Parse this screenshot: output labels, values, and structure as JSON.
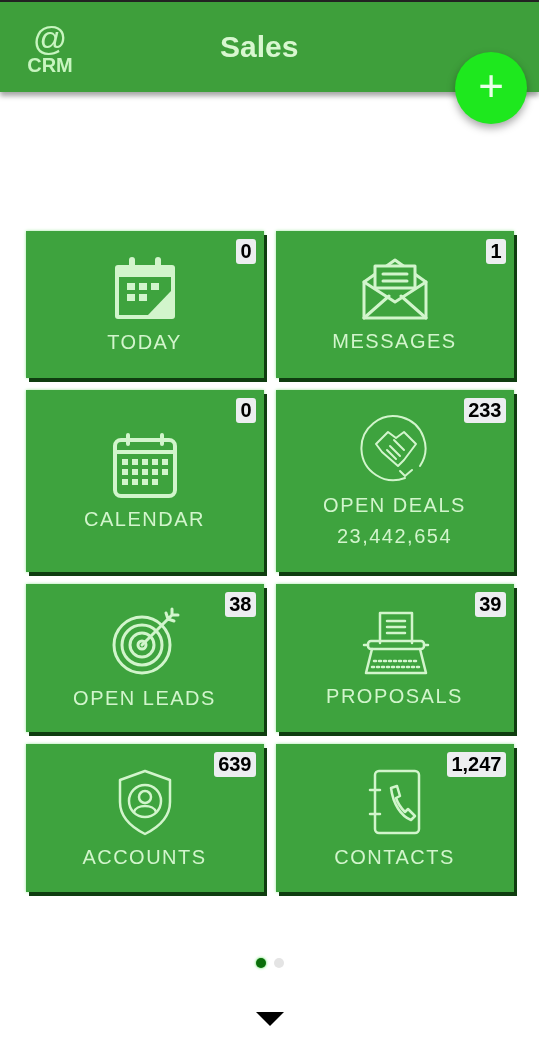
{
  "header": {
    "logo_symbol": "@",
    "logo_text": "CRM",
    "title": "Sales"
  },
  "fab": {
    "symbol": "+"
  },
  "tiles": [
    {
      "kind": "today",
      "label": "TODAY",
      "count": "0"
    },
    {
      "kind": "messages",
      "label": "MESSAGES",
      "count": "1"
    },
    {
      "kind": "calendar",
      "label": "CALENDAR",
      "count": "0"
    },
    {
      "kind": "deals",
      "label": "OPEN DEALS",
      "value": "23,442,654",
      "count": "233"
    },
    {
      "kind": "leads",
      "label": "OPEN LEADS",
      "count": "38"
    },
    {
      "kind": "proposals",
      "label": "PROPOSALS",
      "count": "39"
    },
    {
      "kind": "accounts",
      "label": "ACCOUNTS",
      "count": "639"
    },
    {
      "kind": "contacts",
      "label": "CONTACTS",
      "count": "1,247"
    }
  ],
  "pager": [
    {
      "selected": true
    },
    {
      "selected": false
    }
  ]
}
